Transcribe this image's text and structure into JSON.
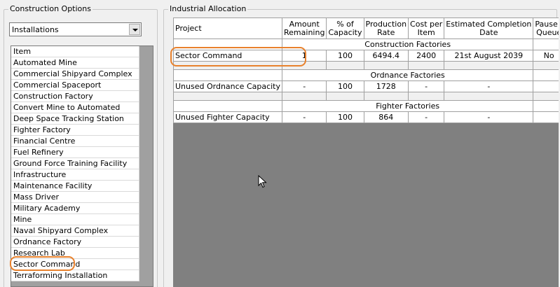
{
  "construction_options": {
    "title": "Construction Options",
    "dropdown_value": "Installations",
    "list_header": "Item",
    "items": [
      "Automated Mine",
      "Commercial Shipyard Complex",
      "Commercial Spaceport",
      "Construction Factory",
      "Convert Mine to Automated",
      "Deep Space Tracking Station",
      "Fighter Factory",
      "Financial Centre",
      "Fuel Refinery",
      "Ground Force Training Facility",
      "Infrastructure",
      "Maintenance Facility",
      "Mass Driver",
      "Military Academy",
      "Mine",
      "Naval Shipyard Complex",
      "Ordnance Factory",
      "Research Lab",
      "Sector Command",
      "Terraforming Installation"
    ]
  },
  "industrial_allocation": {
    "title": "Industrial Allocation",
    "columns": {
      "project": "Project",
      "amount_1": "Amount",
      "amount_2": "Remaining",
      "capacity_1": "% of",
      "capacity_2": "Capacity",
      "rate_1": "Production",
      "rate_2": "Rate",
      "cost_1": "Cost per",
      "cost_2": "Item",
      "completion_1": "Estimated Completion",
      "completion_2": "Date",
      "pause_1": "Pause /",
      "pause_2": "Queue"
    },
    "sections": {
      "construction": "Construction Factories",
      "ordnance": "Ordnance Factories",
      "fighter": "Fighter Factories"
    },
    "rows": {
      "sector_command": {
        "project": "Sector Command",
        "amount": "1",
        "capacity": "100",
        "rate": "6494.4",
        "cost": "2400",
        "completion": "21st August 2039",
        "pause": "No"
      },
      "unused_ordnance": {
        "project": "Unused Ordnance Capacity",
        "amount": "-",
        "capacity": "100",
        "rate": "1728",
        "cost": "-",
        "completion": "-",
        "pause": ""
      },
      "unused_fighter": {
        "project": "Unused Fighter Capacity",
        "amount": "-",
        "capacity": "100",
        "rate": "864",
        "cost": "-",
        "completion": "-",
        "pause": ""
      }
    }
  },
  "colors": {
    "highlight": "#e8812c",
    "grid_bg": "#808080",
    "window_bg": "#f0f0f0"
  }
}
